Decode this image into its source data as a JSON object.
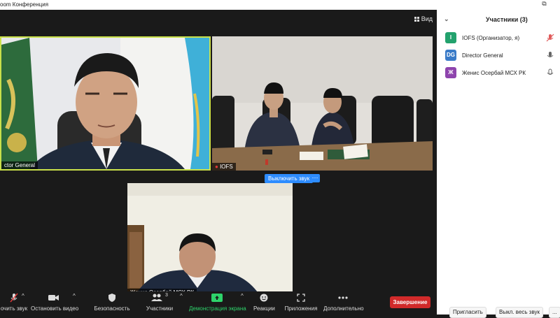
{
  "window": {
    "title": "oom Конференция"
  },
  "view_button": {
    "label": "Вид"
  },
  "videos": [
    {
      "name": "ctor General"
    },
    {
      "name": "IOFS"
    },
    {
      "name": "Женис Осербай МСХ РК"
    }
  ],
  "mute_button": {
    "label": "Выключить звук",
    "more": "···"
  },
  "participants_panel": {
    "title": "Участники (3)",
    "participants": [
      {
        "initials": "I",
        "name": "IOFS (Организатор, я)",
        "avatar_color": "#23a26d"
      },
      {
        "initials": "DG",
        "name": "Director General",
        "avatar_color": "#3a7bc8"
      },
      {
        "initials": "Ж",
        "name": "Женис Осербай МСХ РК",
        "avatar_color": "#8e44ad"
      }
    ],
    "invite_label": "Пригласить",
    "mute_all_label": "Выкл. весь звук",
    "more_label": "..."
  },
  "toolbar": {
    "audio_label": "очить звук",
    "video_label": "Остановить видео",
    "security_label": "Безопасность",
    "participants_label": "Участники",
    "participants_count": "3",
    "share_label": "Демонстрация экрана",
    "reactions_label": "Реакции",
    "apps_label": "Приложения",
    "more_label": "Дополнительно",
    "end_label": "Завершение",
    "share_color": "#2ed36b",
    "end_color": "#d12a2a"
  }
}
